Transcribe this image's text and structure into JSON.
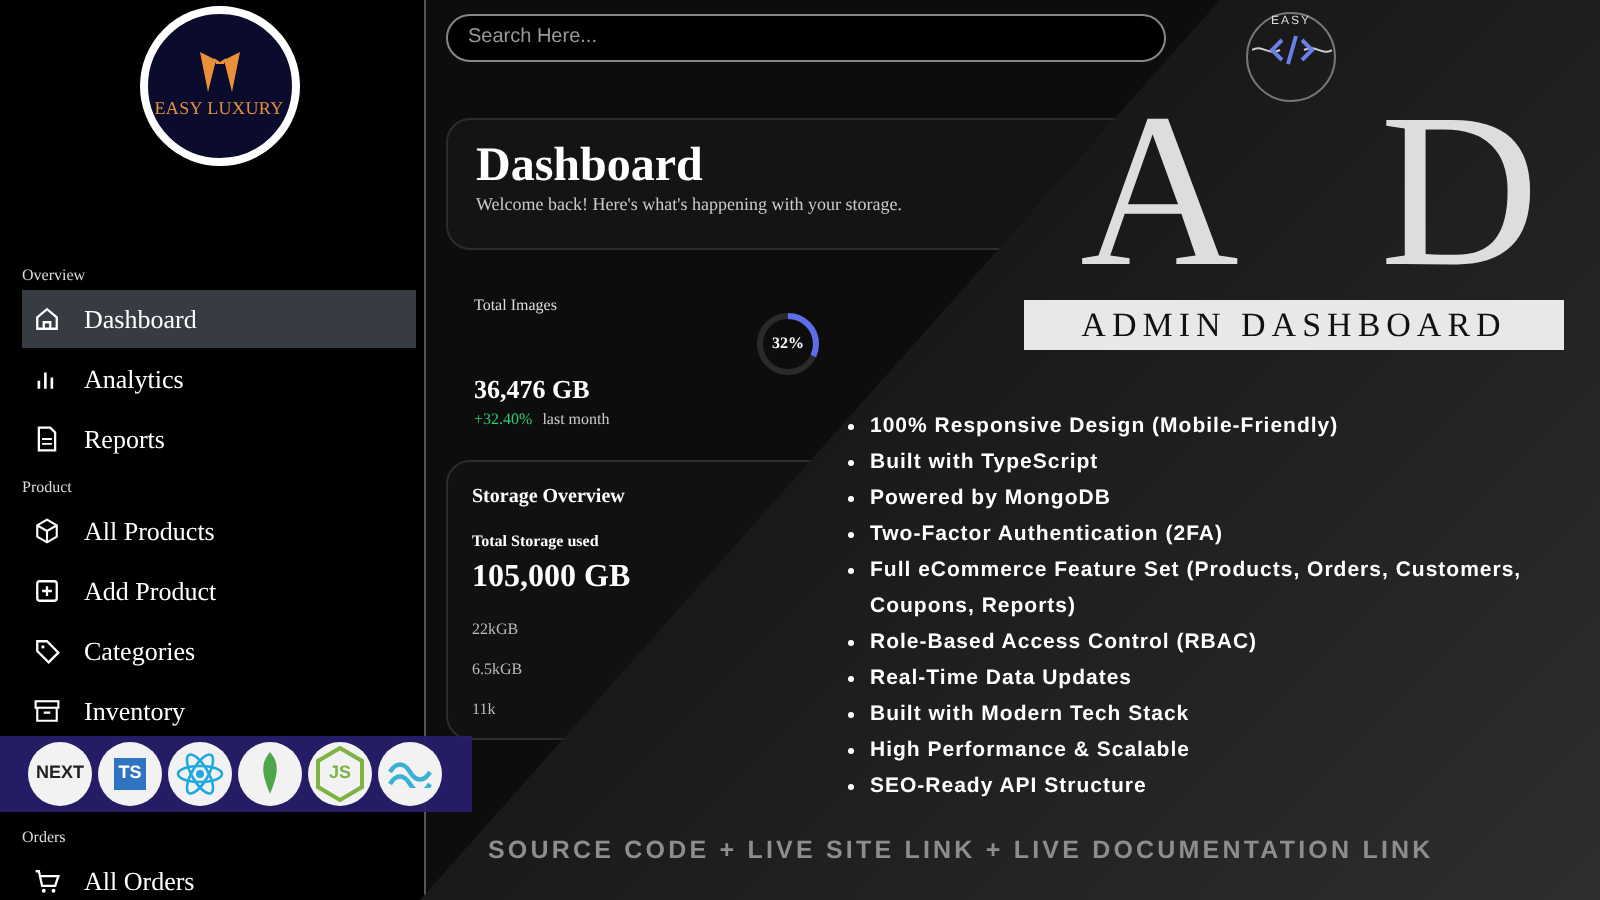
{
  "sidebar": {
    "logo_text": "EASY LUXURY",
    "sections": [
      {
        "label": "Overview",
        "items": [
          {
            "label": "Dashboard",
            "kind": "home",
            "selected": true
          },
          {
            "label": "Analytics",
            "kind": "bars",
            "selected": false
          },
          {
            "label": "Reports",
            "kind": "doc",
            "selected": false
          }
        ]
      },
      {
        "label": "Product",
        "items": [
          {
            "label": "All Products",
            "kind": "cube",
            "selected": false
          },
          {
            "label": "Add Product",
            "kind": "plus",
            "selected": false
          },
          {
            "label": "Categories",
            "kind": "tag",
            "selected": false
          },
          {
            "label": "Inventory",
            "kind": "archive",
            "selected": false
          }
        ]
      },
      {
        "label": "Orders",
        "items": [
          {
            "label": "All Orders",
            "kind": "cart",
            "selected": false
          }
        ]
      }
    ]
  },
  "search": {
    "placeholder": "Search Here..."
  },
  "header": {
    "title": "Dashboard",
    "subtitle": "Welcome back! Here's what's happening with your storage."
  },
  "stat": {
    "label": "Total Images",
    "value": "36,476 GB",
    "change": "+32.40%",
    "period": "last month",
    "ring": {
      "text": "32%",
      "level": 0.32
    }
  },
  "storage": {
    "title": "Storage Overview",
    "label": "Total Storage used",
    "value": "105,000 GB",
    "axis_labels": [
      "22kGB",
      "6.5kGB",
      "11k"
    ]
  },
  "tech_strip": [
    {
      "kind": "next",
      "text": "NEXT"
    },
    {
      "kind": "ts",
      "text": "TS"
    },
    {
      "kind": "react"
    },
    {
      "kind": "mongo"
    },
    {
      "kind": "node",
      "text": "JS"
    },
    {
      "kind": "tailwind"
    }
  ],
  "promo": {
    "logo_text": "EASY",
    "monogram": [
      "A",
      "D"
    ],
    "title": "ADMIN DASHBOARD",
    "features": [
      "100% Responsive Design (Mobile-Friendly)",
      "Built with TypeScript",
      "Powered by MongoDB",
      "Two-Factor Authentication (2FA)",
      "Full eCommerce Feature Set (Products, Orders, Customers, Coupons, Reports)",
      "Role-Based Access Control (RBAC)",
      "Real-Time Data Updates",
      "Built with Modern Tech Stack",
      "High Performance & Scalable",
      "SEO-Ready API Structure"
    ],
    "footer": "SOURCE CODE + LIVE SITE LINK + LIVE DOCUMENTATION LINK"
  }
}
